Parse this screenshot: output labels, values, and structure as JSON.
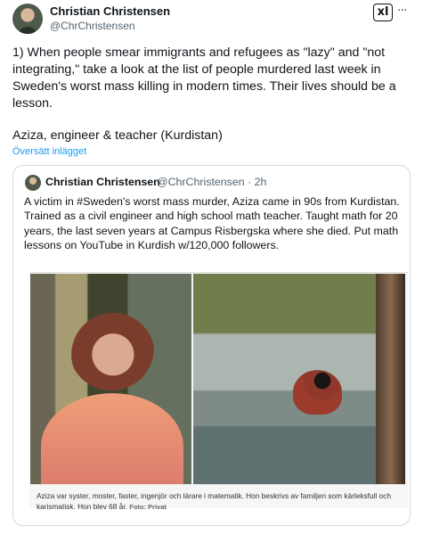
{
  "author": {
    "display_name": "Christian Christensen",
    "handle": "@ChrChristensen",
    "badge_label": "xl",
    "more_label": "···"
  },
  "post": {
    "text": "1) When people smear immigrants and refugees as \"lazy\" and \"not integrating,\" take a look at the list of people murdered last week in Sweden's worst mass killing in modern times. Their lives should be a lesson.",
    "subtext": "Aziza, engineer & teacher (Kurdistan)",
    "translate_label": "Översätt inlägget"
  },
  "quote": {
    "display_name": "Christian Christensen",
    "handle_time": "@ChrChristensen · 2h",
    "text": "A victim in #Sweden's worst mass murder, Aziza came in 90s from Kurdistan. Trained as a civil engineer and high school math teacher. Taught math for 20 years, the last seven years at Campus Risbergska where she died. Put math lessons on YouTube in Kurdish w/120,000 followers.",
    "caption": "Aziza var syster, moster, faster, ingenjör och lärare i matematik. Hon beskrivs av familjen som kärleksfull och karismatisk. Hon blev 68 år.",
    "credit": "Foto: Privat"
  },
  "icons": {
    "avatar": "avatar-icon",
    "badge": "x-logo-icon",
    "more": "more-options-icon"
  }
}
